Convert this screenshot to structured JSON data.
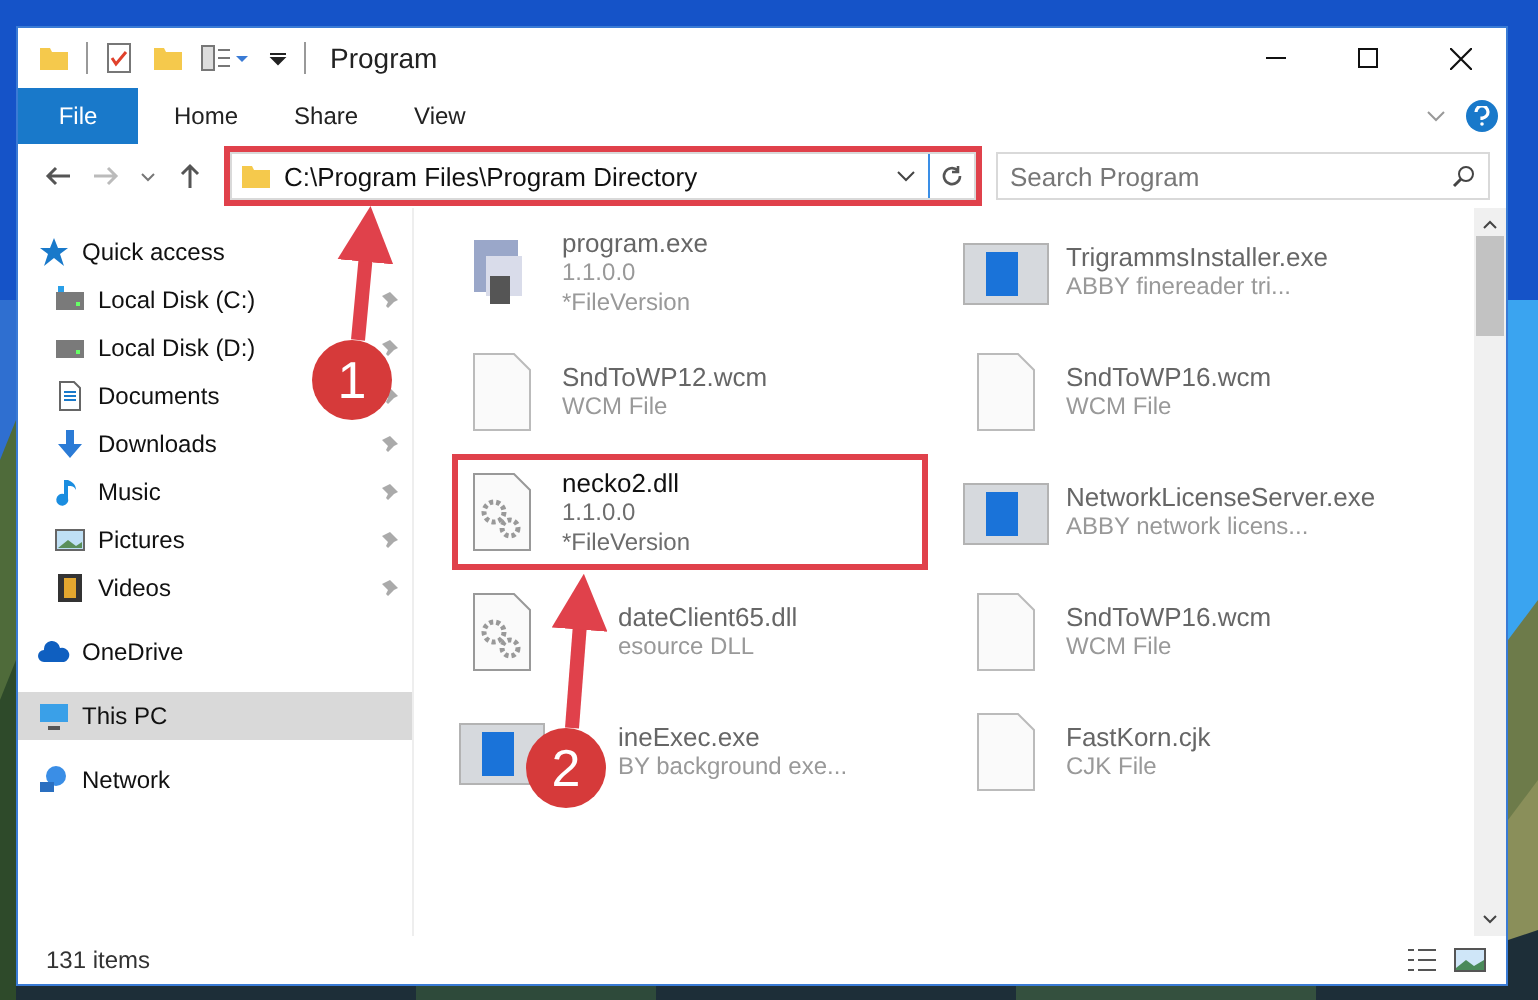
{
  "window": {
    "title": "Program"
  },
  "ribbon": {
    "tabs": [
      {
        "label": "File",
        "kind": "file"
      },
      {
        "label": "Home",
        "kind": "tab"
      },
      {
        "label": "Share",
        "kind": "tab"
      },
      {
        "label": "View",
        "kind": "tab"
      }
    ]
  },
  "address_bar": {
    "path": "C:\\Program Files\\Program Directory",
    "highlighted": true
  },
  "search": {
    "placeholder": "Search Program"
  },
  "sidebar": {
    "items": [
      {
        "label": "Quick access",
        "selected": false,
        "children": [
          {
            "label": "Local Disk (C:)",
            "pinned": true
          },
          {
            "label": "Local Disk (D:)",
            "pinned": true
          },
          {
            "label": "Documents",
            "pinned": true
          },
          {
            "label": "Downloads",
            "pinned": true
          },
          {
            "label": "Music",
            "pinned": true
          },
          {
            "label": "Pictures",
            "pinned": true
          },
          {
            "label": "Videos",
            "pinned": true
          }
        ]
      },
      {
        "label": "OneDrive",
        "selected": false
      },
      {
        "label": "This PC",
        "selected": true
      },
      {
        "label": "Network",
        "selected": false
      }
    ]
  },
  "files": {
    "columns": [
      [
        {
          "name": "program.exe",
          "lines": [
            "1.1.0.0",
            "*FileVersion"
          ],
          "kind": "file",
          "highlighted": false
        },
        {
          "name": "SndToWP12.wcm",
          "lines": [
            "WCM File"
          ],
          "kind": "file",
          "highlighted": false
        },
        {
          "name": "necko2.dll",
          "lines": [
            "1.1.0.0",
            "*FileVersion"
          ],
          "kind": "file",
          "highlighted": true
        },
        {
          "name": "dateClient65.dll",
          "lines": [
            "esource DLL"
          ],
          "kind": "covered",
          "highlighted": false
        },
        {
          "name": "ineExec.exe",
          "lines": [
            "BY background exe..."
          ],
          "kind": "covered",
          "highlighted": false
        }
      ],
      [
        {
          "name": "TrigrammsInstaller.exe",
          "lines": [
            "ABBY finereader tri..."
          ],
          "kind": "file",
          "highlighted": false
        },
        {
          "name": "SndToWP16.wcm",
          "lines": [
            "WCM File"
          ],
          "kind": "file",
          "highlighted": false
        },
        {
          "name": "NetworkLicenseServer.exe",
          "lines": [
            "ABBY network licens..."
          ],
          "kind": "file",
          "highlighted": false
        },
        {
          "name": "SndToWP16.wcm",
          "lines": [
            "WCM File"
          ],
          "kind": "file",
          "highlighted": false
        },
        {
          "name": "FastKorn.cjk",
          "lines": [
            "CJK File"
          ],
          "kind": "file",
          "highlighted": false
        }
      ]
    ]
  },
  "status_bar": {
    "count": "131 items"
  },
  "annotations": {
    "steps": [
      {
        "number": "1"
      },
      {
        "number": "2"
      }
    ]
  }
}
